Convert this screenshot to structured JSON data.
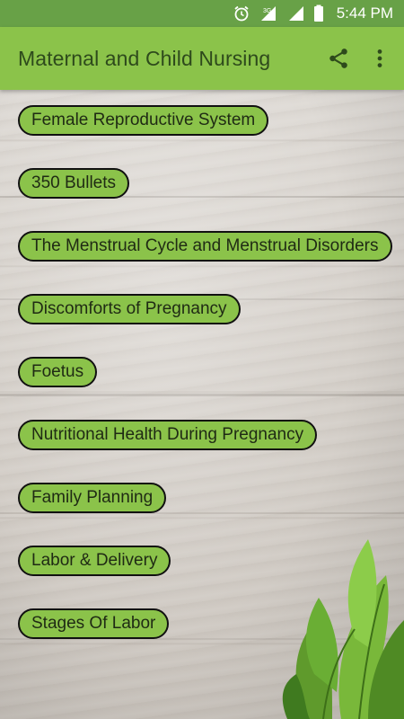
{
  "status_bar": {
    "time": "5:44 PM",
    "network": "3G",
    "icons": [
      "alarm-icon",
      "signal-3g-icon",
      "signal-icon",
      "battery-icon"
    ]
  },
  "app_bar": {
    "title": "Maternal and Child Nursing",
    "actions": [
      "share-icon",
      "more-vert-icon"
    ]
  },
  "menu": {
    "items": [
      {
        "label": "Female Reproductive System"
      },
      {
        "label": "350 Bullets"
      },
      {
        "label": "The Menstrual Cycle and Menstrual Disorders"
      },
      {
        "label": "Discomforts of Pregnancy"
      },
      {
        "label": "Foetus"
      },
      {
        "label": "Nutritional Health During Pregnancy"
      },
      {
        "label": "Family Planning"
      },
      {
        "label": "Labor & Delivery"
      },
      {
        "label": "Stages Of Labor"
      }
    ]
  },
  "colors": {
    "status_bar": "#68a147",
    "app_bar": "#8bc34a",
    "button": "#8bc34a",
    "title_text": "#2e4a1c"
  }
}
